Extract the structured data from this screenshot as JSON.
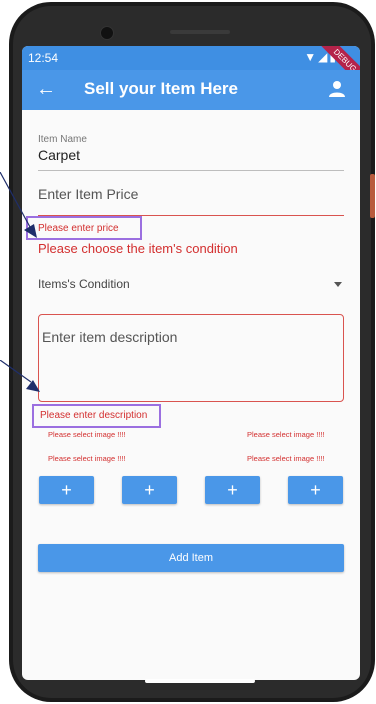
{
  "statusbar": {
    "time": "12:54",
    "icons": "▼◢▮",
    "debug_label": "DEBUG"
  },
  "appbar": {
    "title": "Sell your Item Here",
    "back_icon": "arrow-back-icon",
    "user_icon": "person-icon"
  },
  "form": {
    "item_name_label": "Item Name",
    "item_name_value": "Carpet",
    "price_placeholder": "Enter Item Price",
    "price_error": "Please enter price",
    "condition_error": "Please choose the item's condition",
    "condition_label": "Items's Condition",
    "description_placeholder": "Enter item description",
    "description_error": "Please enter description",
    "image_errors": [
      "Please select image !!!!",
      "Please select image !!!!",
      "Please select image !!!!",
      "Please select image !!!!"
    ],
    "add_image_buttons": [
      "+",
      "+",
      "+",
      "+"
    ],
    "submit_label": "Add Item"
  },
  "colors": {
    "primary": "#4a97e8",
    "error": "#d32f2f",
    "highlight": "#9b6fe0",
    "arrow": "#1f2e6b"
  }
}
